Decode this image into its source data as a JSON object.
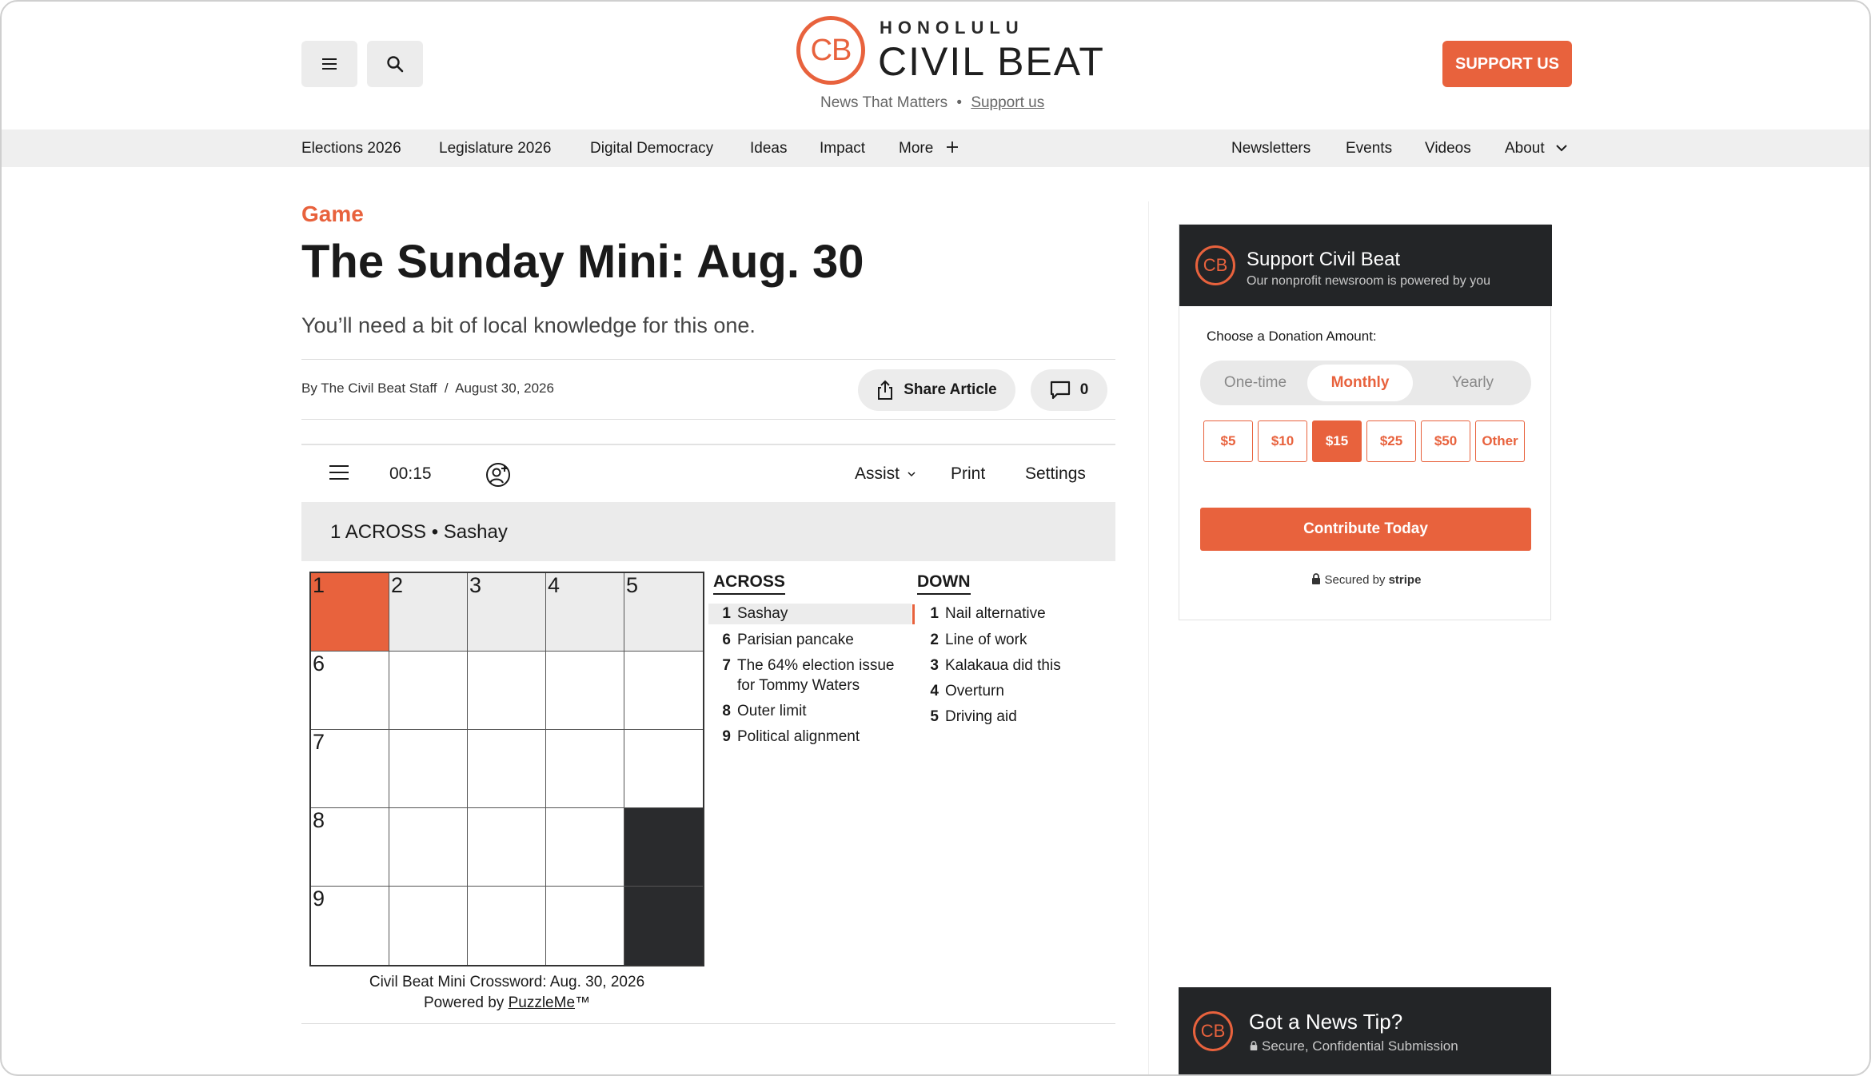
{
  "header": {
    "logo_initials": "CB",
    "logo_top": "HONOLULU",
    "logo_main": "CIVIL BEAT",
    "tagline": "News That Matters",
    "tagline_sep": "•",
    "tagline_link": "Support us",
    "support_label": "SUPPORT US"
  },
  "nav": {
    "left": [
      "Elections 2026",
      "Legislature 2026",
      "Digital Democracy",
      "Ideas",
      "Impact",
      "More"
    ],
    "right": [
      "Newsletters",
      "Events",
      "Videos",
      "About"
    ]
  },
  "article": {
    "kicker": "Game",
    "title": "The Sunday Mini: Aug. 30",
    "dek": "You’ll need a bit of local knowledge for this one.",
    "byline": "By The Civil Beat Staff  /  August 30, 2026",
    "share_label": "Share Article",
    "comment_count": "0"
  },
  "puzzle": {
    "timer": "00:15",
    "tools": {
      "assist": "Assist",
      "print": "Print",
      "settings": "Settings"
    },
    "current_clue": "1 ACROSS • Sashay",
    "grid": {
      "size": 5,
      "numbers": {
        "0,0": "1",
        "0,1": "2",
        "0,2": "3",
        "0,3": "4",
        "0,4": "5",
        "1,0": "6",
        "2,0": "7",
        "3,0": "8",
        "4,0": "9"
      },
      "black": [
        "3,4",
        "4,4"
      ],
      "selected": "0,0",
      "highlighted_row": 0
    },
    "across_label": "ACROSS",
    "down_label": "DOWN",
    "across": [
      {
        "n": "1",
        "text": "Sashay"
      },
      {
        "n": "6",
        "text": "Parisian pancake"
      },
      {
        "n": "7",
        "text": "The 64% election issue for Tommy Waters"
      },
      {
        "n": "8",
        "text": "Outer limit"
      },
      {
        "n": "9",
        "text": "Political alignment"
      }
    ],
    "down": [
      {
        "n": "1",
        "text": "Nail alternative"
      },
      {
        "n": "2",
        "text": "Line of work"
      },
      {
        "n": "3",
        "text": "Kalakaua did this"
      },
      {
        "n": "4",
        "text": "Overturn"
      },
      {
        "n": "5",
        "text": "Driving aid"
      }
    ],
    "caption_line1": "Civil Beat Mini Crossword: Aug. 30, 2026",
    "caption_prefix": "Powered by ",
    "caption_link": "PuzzleMe",
    "caption_suffix": "™"
  },
  "donate": {
    "title": "Support Civil Beat",
    "subtitle": "Our nonprofit newsroom is powered by you",
    "choose_label": "Choose a Donation Amount:",
    "frequencies": [
      "One-time",
      "Monthly",
      "Yearly"
    ],
    "selected_frequency": "Monthly",
    "amounts": [
      "$5",
      "$10",
      "$15",
      "$25",
      "$50",
      "Other"
    ],
    "selected_amount": "$15",
    "cta": "Contribute Today",
    "secured_prefix": "Secured by ",
    "secured_brand": "stripe"
  },
  "tip": {
    "title": "Got a News Tip?",
    "subtitle": "Secure, Confidential Submission"
  },
  "colors": {
    "accent": "#e8623d",
    "dark": "#232527",
    "nav_bg": "#efefef"
  }
}
